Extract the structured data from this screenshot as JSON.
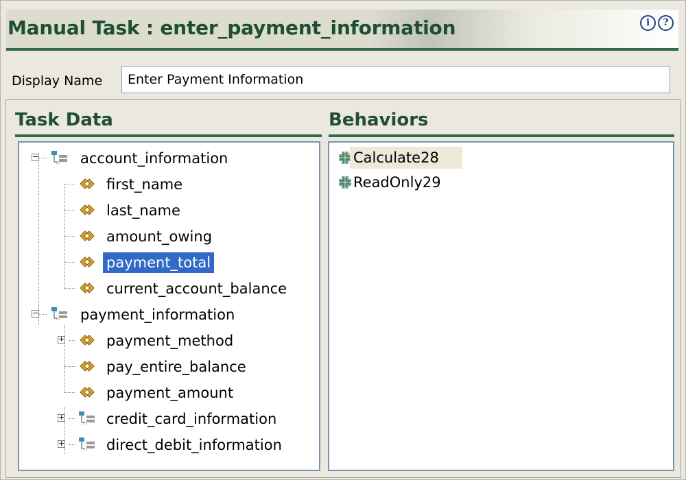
{
  "header": {
    "title": "Manual Task : enter_payment_information",
    "info_glyph": "i",
    "help_glyph": "?"
  },
  "display_name": {
    "label": "Display Name",
    "value": "Enter Payment Information"
  },
  "task_data": {
    "title": "Task Data",
    "tree": [
      {
        "label": "account_information",
        "type": "group",
        "expanded": true,
        "selected": false
      },
      {
        "label": "first_name",
        "type": "field",
        "selected": false
      },
      {
        "label": "last_name",
        "type": "field",
        "selected": false
      },
      {
        "label": "amount_owing",
        "type": "field",
        "selected": false
      },
      {
        "label": "payment_total",
        "type": "field",
        "selected": true
      },
      {
        "label": "current_account_balance",
        "type": "field",
        "selected": false
      },
      {
        "label": "payment_information",
        "type": "group",
        "expanded": true,
        "selected": false
      },
      {
        "label": "payment_method",
        "type": "field",
        "expandable": true,
        "selected": false
      },
      {
        "label": "pay_entire_balance",
        "type": "field",
        "selected": false
      },
      {
        "label": "payment_amount",
        "type": "field",
        "selected": false
      },
      {
        "label": "credit_card_information",
        "type": "group",
        "expandable": true,
        "selected": false
      },
      {
        "label": "direct_debit_information",
        "type": "group",
        "expandable": true,
        "selected": false
      }
    ]
  },
  "behaviors": {
    "title": "Behaviors",
    "items": [
      {
        "label": "Calculate28",
        "icon": "behavior-icon",
        "highlighted": true
      },
      {
        "label": "ReadOnly29",
        "icon": "behavior-icon",
        "highlighted": false
      }
    ]
  },
  "colors": {
    "title_green": "#1f4e33",
    "rule_green": "#2f6b47",
    "selection": "#3169c6",
    "field_icon": "#d9a521",
    "group_icon": "#3a8fb0"
  }
}
